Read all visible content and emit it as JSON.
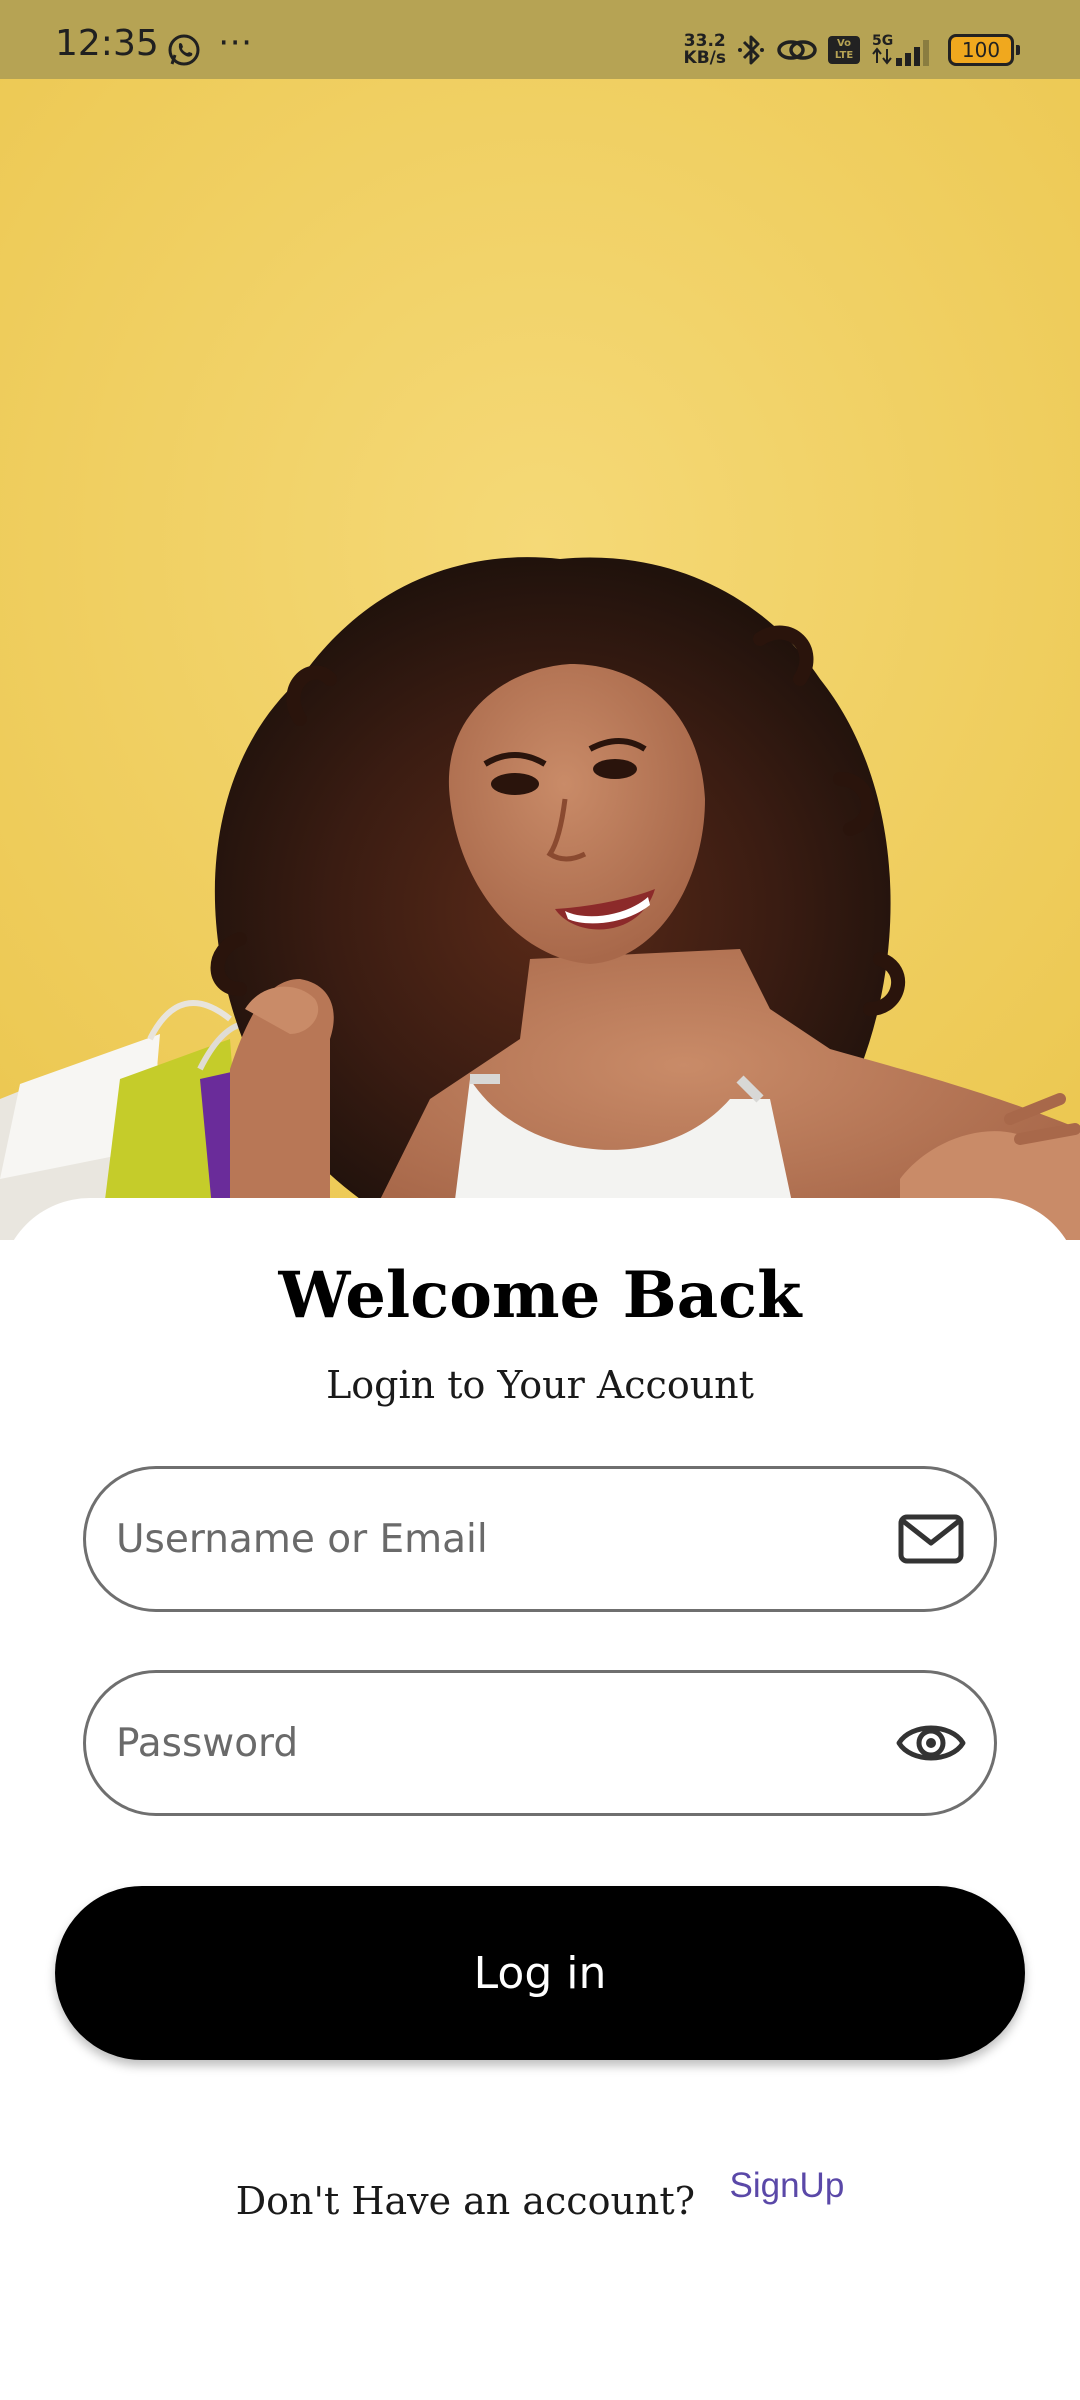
{
  "status_bar": {
    "time": "12:35",
    "more": "⋯",
    "net_speed_value": "33.2",
    "net_speed_unit": "KB/s",
    "volte_line1": "Vo",
    "volte_line2": "LTE",
    "network_type": "5G",
    "battery": "100",
    "icons": [
      "whatsapp-icon",
      "bluetooth-icon",
      "link-icon",
      "volte-icon",
      "signal-icon",
      "battery-icon"
    ]
  },
  "hero": {
    "image": "woman-with-shopping-bags-photo",
    "background_color": "#f2d267"
  },
  "login": {
    "title": "Welcome Back",
    "subtitle": "Login to Your Account",
    "username_placeholder": "Username or Email",
    "username_value": "",
    "username_icon": "envelope-icon",
    "password_placeholder": "Password",
    "password_value": "",
    "password_icon": "eye-icon",
    "login_button": "Log in",
    "signup_prompt": "Don't Have an account?",
    "signup_link": "SignUp"
  },
  "colors": {
    "status_bar": "#b6a354",
    "button": "#000000",
    "link": "#5a48a8",
    "field_border": "#6f6f6f"
  }
}
